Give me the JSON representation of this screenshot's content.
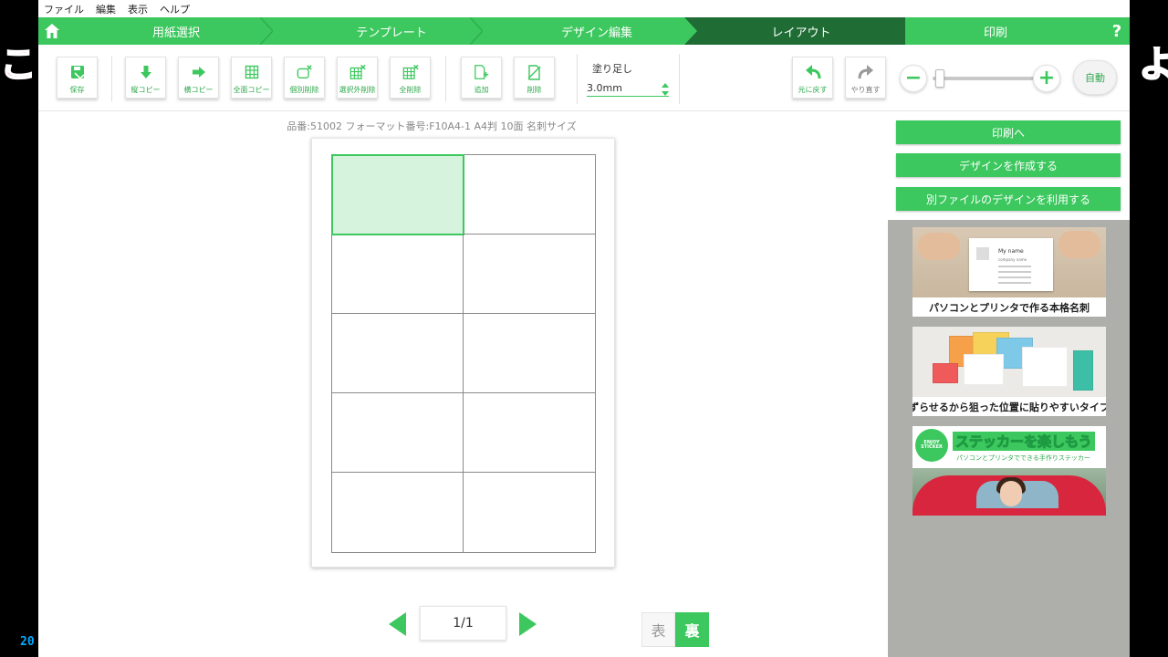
{
  "background": {
    "left_text": "こ イ",
    "right_text": "よ",
    "counter_text": "20"
  },
  "menubar": [
    "ファイル",
    "編集",
    "表示",
    "ヘルプ"
  ],
  "steps": [
    {
      "label": "用紙選択",
      "state": "done"
    },
    {
      "label": "テンプレート",
      "state": "done"
    },
    {
      "label": "デザイン編集",
      "state": "done"
    },
    {
      "label": "レイアウト",
      "state": "active"
    },
    {
      "label": "印刷",
      "state": "todo"
    }
  ],
  "help_label": "?",
  "toolbar": {
    "save": "保存",
    "vertical_copy": "縦コピー",
    "horizontal_copy": "横コピー",
    "all_copy": "全面コピー",
    "individual_delete": "個別削除",
    "delete_unselected": "選択外削除",
    "delete_all": "全削除",
    "add": "追加",
    "remove": "削除",
    "undo": "元に戻す",
    "redo": "やり直す"
  },
  "bleed": {
    "label": "塗り足し",
    "value": "3.0mm"
  },
  "zoom": {
    "minus": "−",
    "plus": "+",
    "auto": "自動",
    "level": 0.05
  },
  "canvas": {
    "info": "品番:51002 フォーマット番号:F10A4-1 A4判 10面 名刺サイズ",
    "cells": 10,
    "selected_cell": 1
  },
  "pager": {
    "text": "1/1"
  },
  "sides": {
    "front": "表",
    "back": "裏",
    "active": "back"
  },
  "actions": {
    "to_print": "印刷へ",
    "create_design": "デザインを作成する",
    "use_other_file": "別ファイルのデザインを利用する"
  },
  "ads": {
    "ad1": {
      "caption": "パソコンとプリンタで作る本格名刺",
      "card_name": "My name",
      "card_company": "company name"
    },
    "ad2": {
      "caption": "ずらせるから狙った位置に貼りやすいタイプ"
    },
    "ad3": {
      "badge": "ENJOY STICKER",
      "title": "ステッカーを楽しもう",
      "subtitle": "パソコンとプリンタでできる手作りステッカー"
    }
  },
  "colors": {
    "accent": "#3cc85e",
    "accent_dark": "#1f6d35",
    "ad_background": "#aeaeaa"
  }
}
